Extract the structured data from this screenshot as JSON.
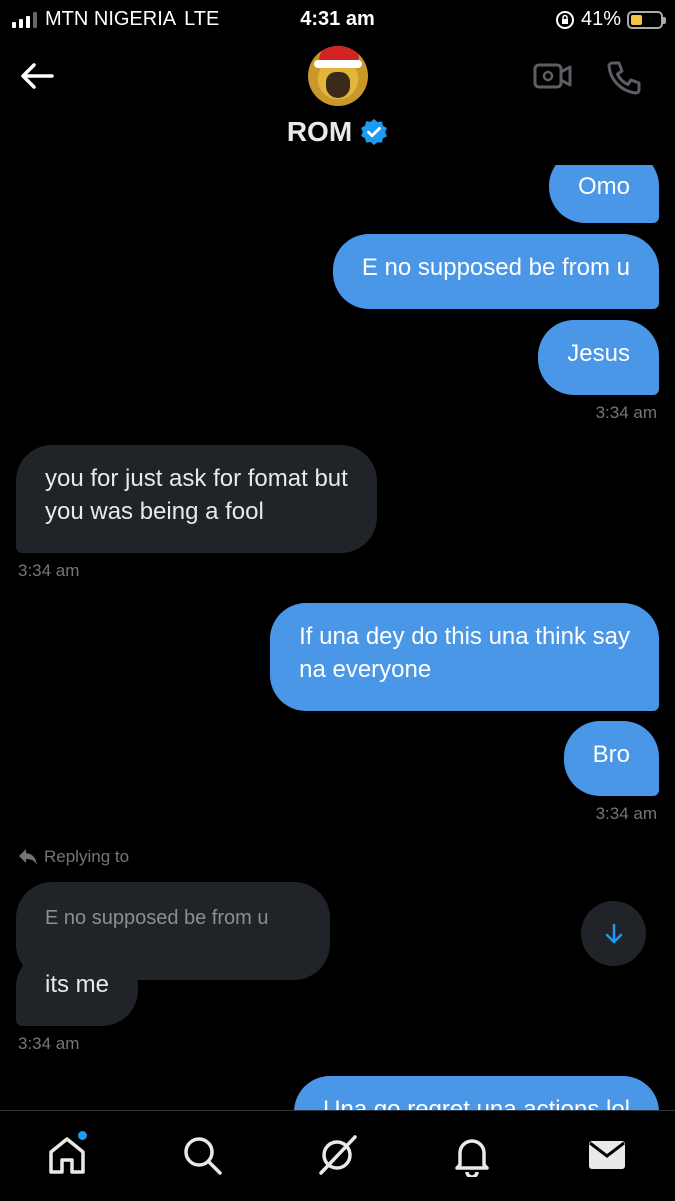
{
  "status_bar": {
    "carrier": "MTN NIGERIA",
    "network": "LTE",
    "time": "4:31 am",
    "battery": "41%",
    "battery_level": 0.41
  },
  "header": {
    "contact_name": "ROM",
    "verified": true
  },
  "messages": [
    {
      "side": "sent",
      "text": "Omo"
    },
    {
      "side": "sent",
      "text": "E no supposed be from u"
    },
    {
      "side": "sent",
      "text": "Jesus",
      "time": "3:34 am"
    },
    {
      "side": "received",
      "line1": "you for just ask for fomat but",
      "line2": "you was being a fool",
      "time": "3:34 am"
    },
    {
      "side": "sent",
      "line1": "If una dey do this una think say",
      "line2": "na everyone"
    },
    {
      "side": "sent",
      "text": "Bro",
      "time": "3:34 am"
    },
    {
      "side": "received",
      "replying_to_label": "Replying to",
      "quoted": "E no supposed be from u",
      "text": "its me",
      "time": "3:34 am"
    },
    {
      "side": "sent",
      "text": "Una go regret una actions lol"
    }
  ],
  "colors": {
    "sent_bubble": "#4a97e8",
    "received_bubble": "#202327",
    "accent": "#1d9bf0",
    "timestamp": "#71767b"
  },
  "nav": {
    "items": [
      "home-icon",
      "search-icon",
      "spaces-icon",
      "notifications-icon",
      "messages-icon"
    ],
    "home_has_notification": true
  }
}
